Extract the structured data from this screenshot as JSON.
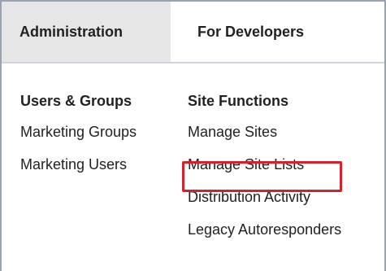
{
  "tabs": [
    {
      "label": "Administration",
      "active": true
    },
    {
      "label": "For Developers",
      "active": false
    }
  ],
  "columns": [
    {
      "heading": "Users & Groups",
      "items": [
        "Marketing Groups",
        "Marketing Users"
      ]
    },
    {
      "heading": "Site Functions",
      "items": [
        "Manage Sites",
        "Manage Site Lists",
        "Distribution Activity",
        "Legacy Autoresponders"
      ]
    }
  ],
  "colors": {
    "active_tab_bg": "#e6e6e6",
    "highlight_border": "#d6202b",
    "frame_border": "#98a2b3"
  }
}
